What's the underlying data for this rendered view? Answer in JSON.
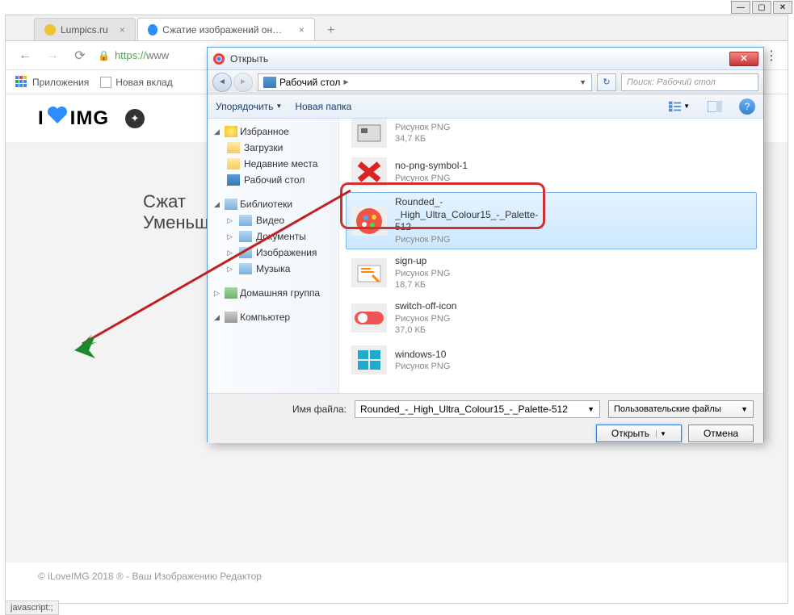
{
  "browser": {
    "tabs": [
      {
        "title": "Lumpics.ru",
        "favicon": "lumpics"
      },
      {
        "title": "Сжатие изображений онлайн F",
        "favicon": "iloveimg"
      }
    ],
    "url_prefix": "https://",
    "url_rest": "www",
    "bookmarks": {
      "apps_label": "Приложения",
      "new_tab_label": "Новая вклад"
    }
  },
  "page": {
    "logo_i": "I",
    "logo_img": "IMG",
    "title_line1": "Сжат",
    "title_line2": "Уменьш",
    "footer": "© iLoveIMG 2018 ® - Ваш Изображению Редактор",
    "js_status": "javascript:;"
  },
  "dialog": {
    "title": "Открыть",
    "breadcrumb": "Рабочий стол",
    "breadcrumb_sep": "▶",
    "search_placeholder": "Поиск: Рабочий стол",
    "toolbar": {
      "organize": "Упорядочить",
      "new_folder": "Новая папка"
    },
    "sidebar": {
      "favorites": "Избранное",
      "fav_items": [
        "Загрузки",
        "Недавние места",
        "Рабочий стол"
      ],
      "libraries": "Библиотеки",
      "lib_items": [
        "Видео",
        "Документы",
        "Изображения",
        "Музыка"
      ],
      "homegroup": "Домашняя группа",
      "computer": "Компьютер"
    },
    "files": [
      {
        "name": "",
        "type": "Рисунок PNG",
        "size": "34,7 КБ",
        "thumb": "chip"
      },
      {
        "name": "no-png-symbol-1",
        "type": "Рисунок PNG",
        "size": "",
        "thumb": "redx"
      },
      {
        "name": "Rounded_-_High_Ultra_Colour15_-_Palette-512",
        "type": "Рисунок PNG",
        "size": "",
        "thumb": "palette",
        "selected": true
      },
      {
        "name": "sign-up",
        "type": "Рисунок PNG",
        "size": "18,7 КБ",
        "thumb": "signup"
      },
      {
        "name": "switch-off-icon",
        "type": "Рисунок PNG",
        "size": "37,0 КБ",
        "thumb": "switch"
      },
      {
        "name": "windows-10",
        "type": "Рисунок PNG",
        "size": "",
        "thumb": "win"
      }
    ],
    "footer": {
      "filename_label": "Имя файла:",
      "filename_value": "Rounded_-_High_Ultra_Colour15_-_Palette-512",
      "filetype": "Пользовательские файлы",
      "open_btn": "Открыть",
      "cancel_btn": "Отмена"
    }
  }
}
